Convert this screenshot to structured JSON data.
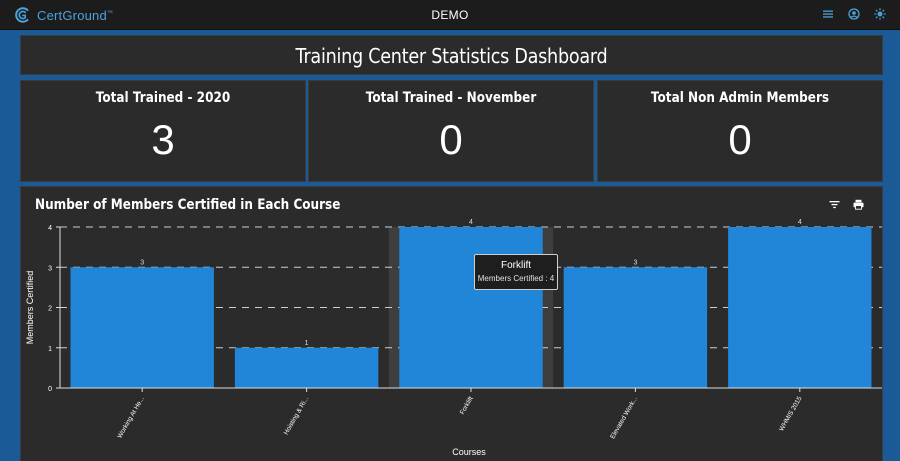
{
  "topbar": {
    "brand": "CertGround",
    "brand_tm": "™",
    "title": "DEMO",
    "icons": [
      "menu-icon",
      "account-circle-icon",
      "brightness-icon"
    ]
  },
  "header": {
    "title": "Training Center Statistics Dashboard"
  },
  "stats": [
    {
      "title": "Total Trained - 2020",
      "value": "3"
    },
    {
      "title": "Total Trained - November",
      "value": "0"
    },
    {
      "title": "Total Non Admin Members",
      "value": "0"
    }
  ],
  "chart_panel": {
    "title": "Number of Members Certified in Each Course",
    "tools": [
      "filter-icon",
      "print-icon"
    ]
  },
  "tooltip": {
    "title": "Forklift",
    "body": "Members Certified : 4"
  },
  "chart_data": {
    "type": "bar",
    "categories": [
      "Working At He...",
      "Hoisting & Ri...",
      "Forklift",
      "Elevated Work...",
      "WHMIS 2015"
    ],
    "values": [
      3,
      1,
      4,
      3,
      4
    ],
    "highlighted_category": "Forklift",
    "xlabel": "Courses",
    "ylabel": "Members Certified",
    "ylim": [
      0,
      4
    ],
    "yticks": [
      "0",
      "1",
      "2",
      "3",
      "4"
    ],
    "data_labels": [
      "3",
      "1",
      "4",
      "3",
      "4"
    ],
    "colors": {
      "bar": "#2185d8",
      "highlight_band": "#3e3e3e",
      "grid": "#cfcfcf",
      "axis": "#dddddd"
    },
    "grid": true
  }
}
